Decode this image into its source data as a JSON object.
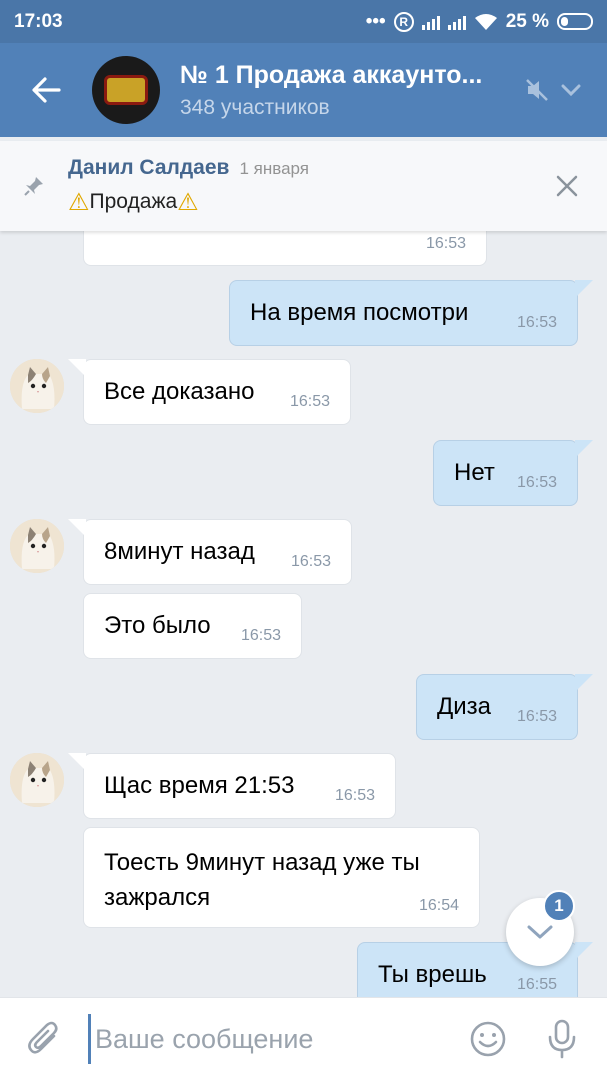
{
  "status": {
    "time": "17:03",
    "battery": "25 %"
  },
  "header": {
    "title": "№ 1 Продажа аккаунто...",
    "subtitle": "348 участников"
  },
  "pinned": {
    "author": "Данил Салдаев",
    "date": "1 января",
    "text": "Продажа"
  },
  "messages": [
    {
      "text": "",
      "time": "16:53"
    },
    {
      "text": "На время посмотри",
      "time": "16:53"
    },
    {
      "text": "Все доказано",
      "time": "16:53"
    },
    {
      "text": "Нет",
      "time": "16:53"
    },
    {
      "text": "8минут назад",
      "time": "16:53"
    },
    {
      "text": "Это было",
      "time": "16:53"
    },
    {
      "text": "Диза",
      "time": "16:53"
    },
    {
      "text": "Щас время 21:53",
      "time": "16:53"
    },
    {
      "text": "Тоесть 9минут назад уже ты зажрался",
      "time": "16:54"
    },
    {
      "text": "Ты врешь",
      "time": "16:55"
    }
  ],
  "fab": {
    "badge": "1"
  },
  "input": {
    "placeholder": "Ваше сообщение"
  },
  "colors": {
    "header": "#5181b8",
    "statusbar": "#4a76a8",
    "outgoing": "#cce4f7",
    "incoming": "#ffffff",
    "background": "#eaedf1"
  }
}
